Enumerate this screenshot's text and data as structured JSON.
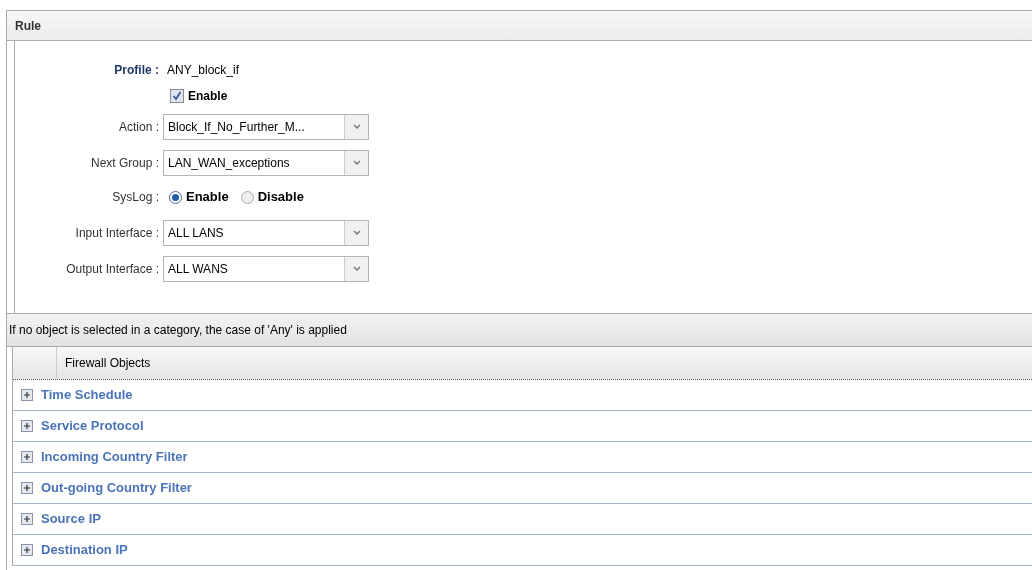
{
  "panel": {
    "title": "Rule"
  },
  "profile": {
    "label": "Profile :",
    "value": "ANY_block_if"
  },
  "enable": {
    "label": "Enable",
    "checked": true
  },
  "selects": [
    {
      "label": "Action :",
      "value": "Block_If_No_Further_M..."
    },
    {
      "label": "Next Group :",
      "value": "LAN_WAN_exceptions"
    }
  ],
  "syslog": {
    "label": "SysLog :",
    "options": [
      {
        "label": "Enable",
        "selected": true
      },
      {
        "label": "Disable",
        "selected": false
      }
    ]
  },
  "interfaces": [
    {
      "label": "Input Interface :",
      "value": "ALL LANS"
    },
    {
      "label": "Output Interface :",
      "value": "ALL WANS"
    }
  ],
  "info": "If no object is selected in a category, the case of 'Any' is applied",
  "table": {
    "column": "Firewall Objects",
    "rows": [
      {
        "label": "Time Schedule",
        "expanded": false
      },
      {
        "label": "Service Protocol",
        "expanded": false
      },
      {
        "label": "Incoming Country Filter",
        "expanded": false
      },
      {
        "label": "Out-going Country Filter",
        "expanded": false
      },
      {
        "label": "Source IP",
        "expanded": false
      },
      {
        "label": "Destination IP",
        "expanded": false
      }
    ]
  }
}
